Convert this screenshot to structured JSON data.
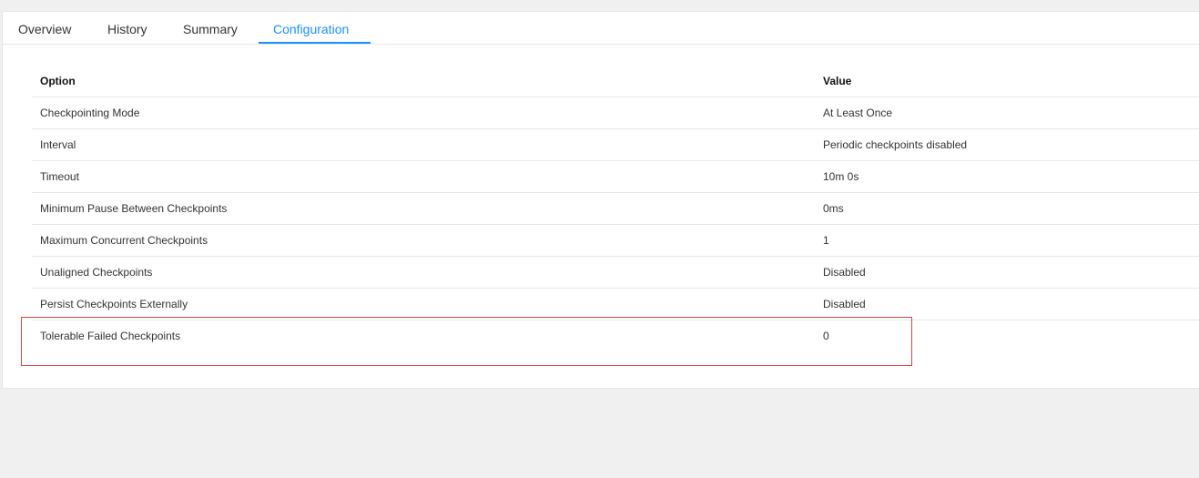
{
  "tabs": [
    {
      "label": "Overview",
      "active": false
    },
    {
      "label": "History",
      "active": false
    },
    {
      "label": "Summary",
      "active": false
    },
    {
      "label": "Configuration",
      "active": true
    }
  ],
  "table": {
    "headers": {
      "option": "Option",
      "value": "Value"
    },
    "rows": [
      {
        "option": "Checkpointing Mode",
        "value": "At Least Once"
      },
      {
        "option": "Interval",
        "value": "Periodic checkpoints disabled"
      },
      {
        "option": "Timeout",
        "value": "10m 0s"
      },
      {
        "option": "Minimum Pause Between Checkpoints",
        "value": "0ms"
      },
      {
        "option": "Maximum Concurrent Checkpoints",
        "value": "1"
      },
      {
        "option": "Unaligned Checkpoints",
        "value": "Disabled"
      },
      {
        "option": "Persist Checkpoints Externally",
        "value": "Disabled"
      },
      {
        "option": "Tolerable Failed Checkpoints",
        "value": "0"
      }
    ]
  },
  "colors": {
    "accent": "#1890ff",
    "highlight_border": "#d9483f",
    "text": "#333333",
    "divider": "#e8e8e8"
  }
}
